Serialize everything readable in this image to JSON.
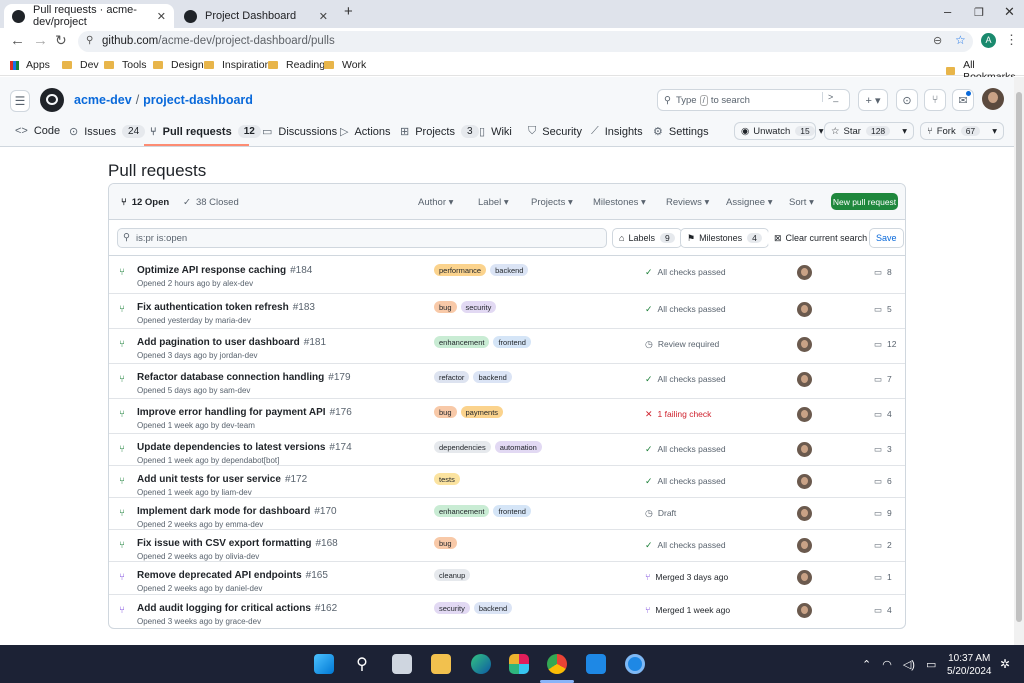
{
  "browser": {
    "tabs": [
      {
        "title": "Pull requests · acme-dev/project",
        "active": true
      },
      {
        "title": "Project Dashboard",
        "active": false
      }
    ],
    "new_tab": "+",
    "url_domain": "github.com",
    "url_path": "/acme-dev/project-dashboard/pulls",
    "profile_initial": "A",
    "bookmarks": [
      "Apps",
      "Dev",
      "Tools",
      "Design",
      "Inspiration",
      "Reading",
      "Work"
    ],
    "all_bookmarks": "All Bookmarks"
  },
  "github": {
    "owner": "acme-dev",
    "repo": "project-dashboard",
    "search_placeholder_pre": "Type",
    "search_key": "/",
    "search_placeholder_post": "to search",
    "repo_tabs": [
      {
        "label": "Code",
        "icon": "code-icon",
        "count": ""
      },
      {
        "label": "Issues",
        "icon": "issue-icon",
        "count": "24"
      },
      {
        "label": "Pull requests",
        "icon": "pull-request-icon",
        "count": "12"
      },
      {
        "label": "Discussions",
        "icon": "discussion-icon",
        "count": ""
      },
      {
        "label": "Actions",
        "icon": "actions-icon",
        "count": ""
      },
      {
        "label": "Projects",
        "icon": "projects-icon",
        "count": "3"
      },
      {
        "label": "Wiki",
        "icon": "wiki-icon",
        "count": ""
      },
      {
        "label": "Security",
        "icon": "shield-icon",
        "count": ""
      },
      {
        "label": "Insights",
        "icon": "graph-icon",
        "count": ""
      },
      {
        "label": "Settings",
        "icon": "gear-icon",
        "count": ""
      }
    ],
    "watch": {
      "label": "Unwatch",
      "count": "15"
    },
    "star": {
      "label": "Star",
      "count": "128"
    },
    "fork": {
      "label": "Fork",
      "count": "67"
    }
  },
  "page": {
    "title": "Pull requests",
    "open_label": "12 Open",
    "closed_label": "38 Closed",
    "filters": [
      "Author",
      "Label",
      "Projects",
      "Milestones",
      "Reviews",
      "Assignee",
      "Sort"
    ],
    "new_pr": "New pull request",
    "search_value": "is:pr is:open",
    "labels_btn": {
      "label": "Labels",
      "count": "9"
    },
    "milestones_btn": {
      "label": "Milestones",
      "count": "4"
    },
    "clear_search": "Clear current search",
    "save": "Save"
  },
  "pull_requests": [
    {
      "title": "Optimize API response caching",
      "number": "#184",
      "meta": "Opened 2 hours ago by alex-dev",
      "state": "open",
      "labels": [
        {
          "name": "performance",
          "color": "#fbd38d"
        },
        {
          "name": "backend",
          "color": "#dbe4f5"
        }
      ],
      "check": "All checks passed",
      "check_type": "pass",
      "comments": "8"
    },
    {
      "title": "Fix authentication token refresh",
      "number": "#183",
      "meta": "Opened yesterday by maria-dev",
      "state": "open",
      "labels": [
        {
          "name": "bug",
          "color": "#f8c9a8"
        },
        {
          "name": "security",
          "color": "#e2d9f3"
        }
      ],
      "check": "All checks passed",
      "check_type": "pass",
      "comments": "5"
    },
    {
      "title": "Add pagination to user dashboard",
      "number": "#181",
      "meta": "Opened 3 days ago by jordan-dev",
      "state": "open",
      "labels": [
        {
          "name": "enhancement",
          "color": "#c9ecd4"
        },
        {
          "name": "frontend",
          "color": "#d5e5f7"
        }
      ],
      "check": "Review required",
      "check_type": "pending",
      "comments": "12"
    },
    {
      "title": "Refactor database connection handling",
      "number": "#179",
      "meta": "Opened 5 days ago by sam-dev",
      "state": "open",
      "labels": [
        {
          "name": "refactor",
          "color": "#dde3f0"
        },
        {
          "name": "backend",
          "color": "#dbe4f5"
        }
      ],
      "check": "All checks passed",
      "check_type": "pass",
      "comments": "7"
    },
    {
      "title": "Improve error handling for payment API",
      "number": "#176",
      "meta": "Opened 1 week ago by dev-team",
      "state": "open",
      "labels": [
        {
          "name": "bug",
          "color": "#f8c9a8"
        },
        {
          "name": "payments",
          "color": "#fbd38d"
        }
      ],
      "check": "1 failing check",
      "check_type": "fail",
      "comments": "4"
    },
    {
      "title": "Update dependencies to latest versions",
      "number": "#174",
      "meta": "Opened 1 week ago by dependabot[bot]",
      "state": "open",
      "labels": [
        {
          "name": "dependencies",
          "color": "#e6e9ed"
        },
        {
          "name": "automation",
          "color": "#e2d9f3"
        }
      ],
      "check": "All checks passed",
      "check_type": "pass",
      "comments": "3"
    },
    {
      "title": "Add unit tests for user service",
      "number": "#172",
      "meta": "Opened 1 week ago by liam-dev",
      "state": "open",
      "labels": [
        {
          "name": "tests",
          "color": "#fbe3a0"
        }
      ],
      "check": "All checks passed",
      "check_type": "pass",
      "comments": "6"
    },
    {
      "title": "Implement dark mode for dashboard",
      "number": "#170",
      "meta": "Opened 2 weeks ago by emma-dev",
      "state": "open",
      "labels": [
        {
          "name": "enhancement",
          "color": "#c9ecd4"
        },
        {
          "name": "frontend",
          "color": "#d5e5f7"
        }
      ],
      "check": "Draft",
      "check_type": "draft",
      "comments": "9"
    },
    {
      "title": "Fix issue with CSV export formatting",
      "number": "#168",
      "meta": "Opened 2 weeks ago by olivia-dev",
      "state": "open",
      "labels": [
        {
          "name": "bug",
          "color": "#f8c9a8"
        }
      ],
      "check": "All checks passed",
      "check_type": "pass",
      "comments": "2"
    },
    {
      "title": "Remove deprecated API endpoints",
      "number": "#165",
      "meta": "Opened 2 weeks ago by daniel-dev",
      "state": "merged",
      "labels": [
        {
          "name": "cleanup",
          "color": "#e6e9ed"
        }
      ],
      "check": "Merged 3 days ago",
      "check_type": "merged",
      "comments": "1"
    },
    {
      "title": "Add audit logging for critical actions",
      "number": "#162",
      "meta": "Opened 3 weeks ago by grace-dev",
      "state": "merged",
      "labels": [
        {
          "name": "security",
          "color": "#e2d9f3"
        },
        {
          "name": "backend",
          "color": "#dbe4f5"
        }
      ],
      "check": "Merged 1 week ago",
      "check_type": "merged",
      "comments": "4"
    }
  ],
  "taskbar": {
    "time": "10:37 AM",
    "date": "5/20/2024"
  },
  "colors": {
    "accent": "#0969da",
    "success": "#1a7f37",
    "merged": "#8250df",
    "danger": "#cf222e",
    "new_pr_button": "#1f883d"
  }
}
